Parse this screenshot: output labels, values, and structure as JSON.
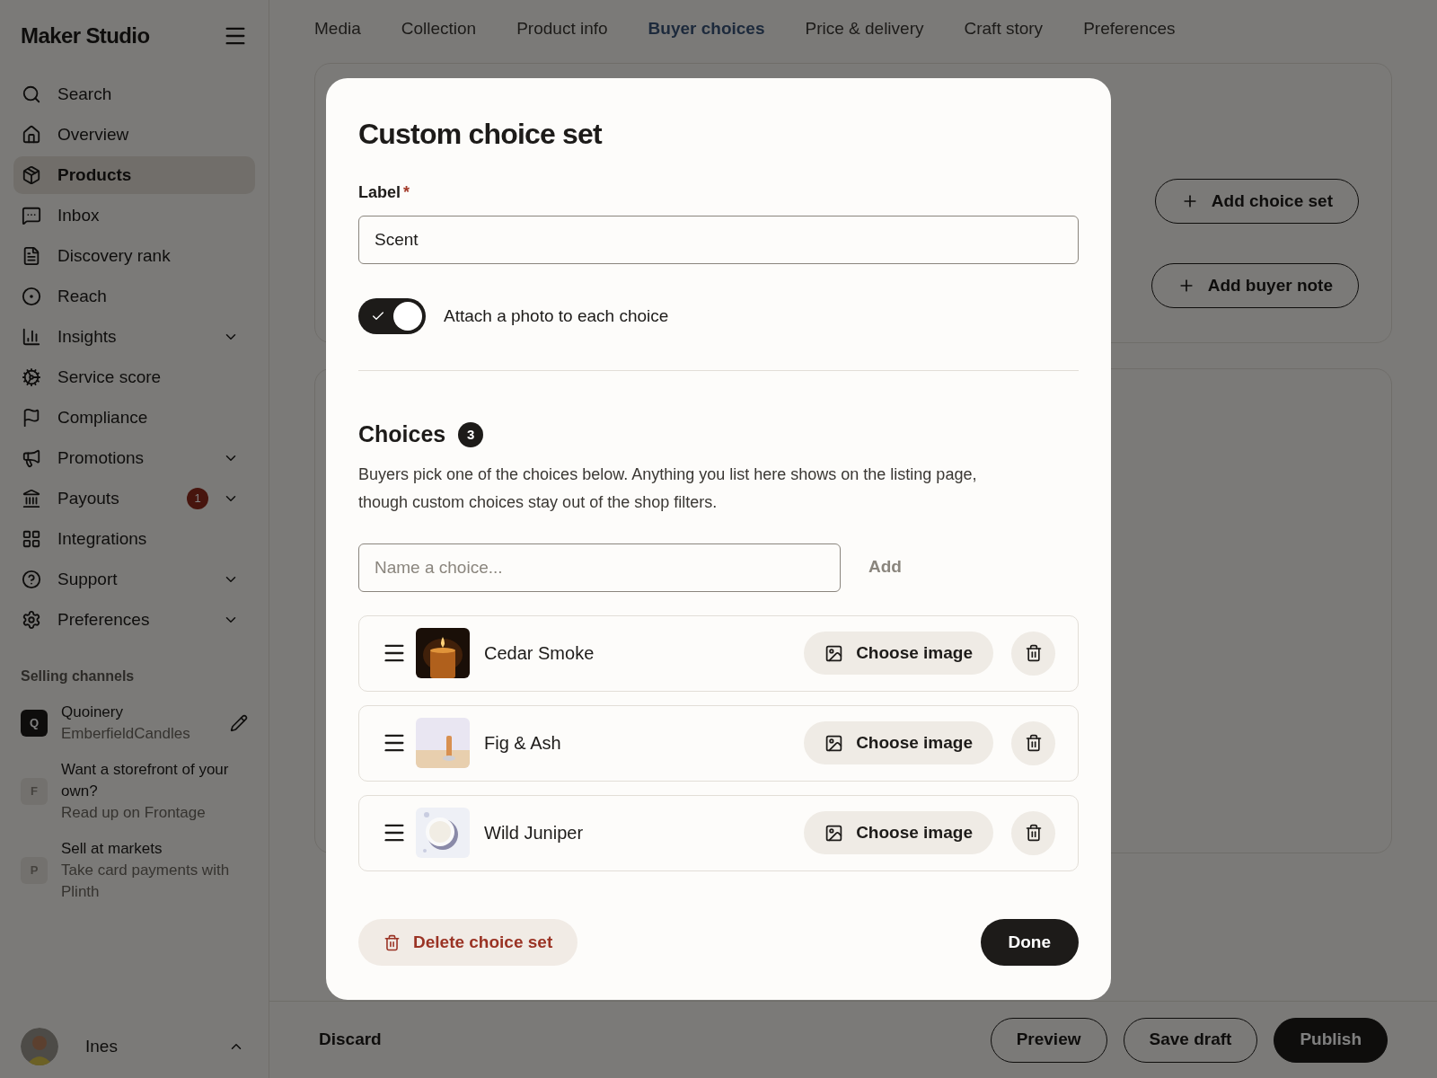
{
  "sidebar": {
    "brand": "Maker Studio",
    "items": [
      {
        "label": "Search",
        "selected": false,
        "expandable": false
      },
      {
        "label": "Overview",
        "selected": false,
        "expandable": false
      },
      {
        "label": "Products",
        "selected": true,
        "expandable": false
      },
      {
        "label": "Inbox",
        "selected": false,
        "expandable": false
      },
      {
        "label": "Discovery rank",
        "selected": false,
        "expandable": false
      },
      {
        "label": "Reach",
        "selected": false,
        "expandable": false
      },
      {
        "label": "Insights",
        "selected": false,
        "expandable": true
      },
      {
        "label": "Service score",
        "selected": false,
        "expandable": false
      },
      {
        "label": "Compliance",
        "selected": false,
        "expandable": false
      },
      {
        "label": "Promotions",
        "selected": false,
        "expandable": true
      },
      {
        "label": "Payouts",
        "selected": false,
        "expandable": true,
        "badge": "1"
      },
      {
        "label": "Integrations",
        "selected": false,
        "expandable": false
      },
      {
        "label": "Support",
        "selected": false,
        "expandable": true
      },
      {
        "label": "Preferences",
        "selected": false,
        "expandable": true
      }
    ],
    "channels_heading": "Selling channels",
    "channels": [
      {
        "letter": "Q",
        "title": "Quoinery",
        "subtitle": "EmberfieldCandles",
        "connected": true
      },
      {
        "letter": "F",
        "title": "Want a storefront of your own?",
        "subtitle": "Read up on Frontage",
        "connected": false
      },
      {
        "letter": "P",
        "title": "Sell at markets",
        "subtitle": "Take card payments with Plinth",
        "connected": false
      }
    ],
    "user": {
      "name": "Ines"
    }
  },
  "tabs": [
    {
      "label": "Media",
      "selected": false
    },
    {
      "label": "Collection",
      "selected": false
    },
    {
      "label": "Product info",
      "selected": false
    },
    {
      "label": "Buyer choices",
      "selected": true
    },
    {
      "label": "Price & delivery",
      "selected": false
    },
    {
      "label": "Craft story",
      "selected": false
    },
    {
      "label": "Preferences",
      "selected": false
    }
  ],
  "background_actions": [
    "Add choice set",
    "Add buyer note"
  ],
  "bottom_bar": {
    "discard": "Discard",
    "buttons": [
      {
        "label": "Preview",
        "primary": false
      },
      {
        "label": "Save draft",
        "primary": false
      },
      {
        "label": "Publish",
        "primary": true
      }
    ]
  },
  "dialog": {
    "title": "Custom choice set",
    "label_field": {
      "label": "Label",
      "required_mark": "*",
      "value": "Scent"
    },
    "photo_toggle": {
      "label": "Attach a photo to each choice",
      "on": true
    },
    "choices_heading": "Choices",
    "choices_count": "3",
    "description": "Buyers pick one of the choices below. Anything you list here shows on the listing page, though custom choices stay out of the shop filters.",
    "new_choice": {
      "placeholder": "Name a choice...",
      "add_label": "Add",
      "add_disabled": true
    },
    "choices": [
      {
        "name": "Cedar Smoke",
        "button": "Choose image"
      },
      {
        "name": "Fig & Ash",
        "button": "Choose image"
      },
      {
        "name": "Wild Juniper",
        "button": "Choose image"
      }
    ],
    "delete_label": "Delete choice set",
    "done_label": "Done"
  }
}
